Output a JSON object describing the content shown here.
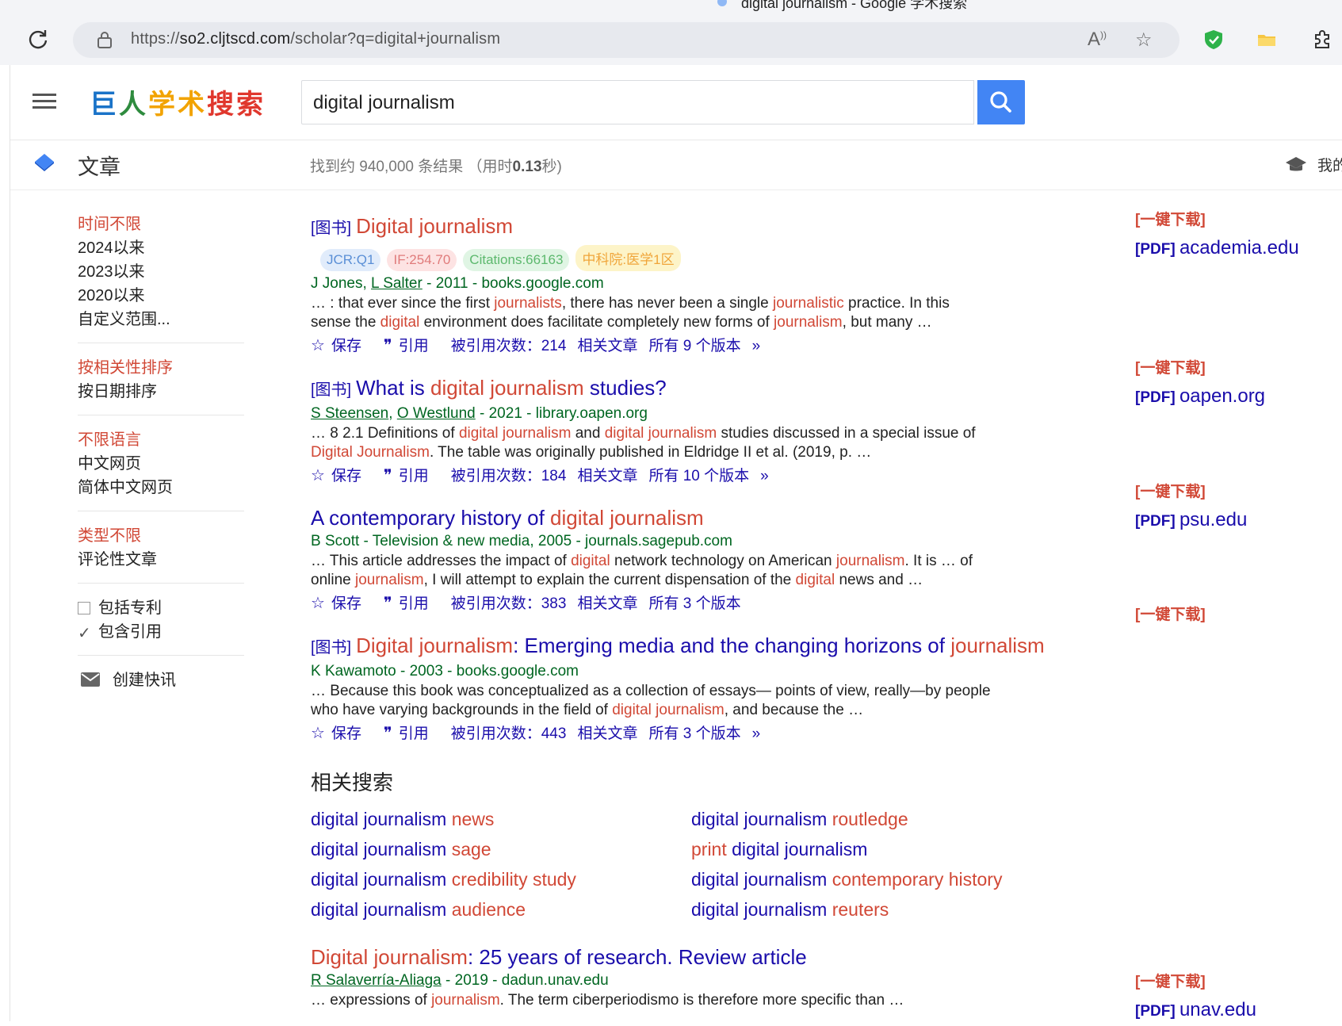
{
  "browser": {
    "tab_title": "digital journalism - Google 学术搜索",
    "url_prefix": "https://",
    "url_host": "so2.cljtscd.com",
    "url_path": "/scholar?q=digital+journalism"
  },
  "header": {
    "logo": [
      "巨",
      "人",
      "学术",
      "搜索"
    ],
    "search_value": "digital journalism"
  },
  "subbar": {
    "section": "文章",
    "stats_prefix": "找到约 940,000 条结果 （用时",
    "stats_time": "0.13",
    "stats_suffix": "秒)",
    "my_library": "我的"
  },
  "sidebar": {
    "time": [
      "时间不限",
      "2024以来",
      "2023以来",
      "2020以来",
      "自定义范围..."
    ],
    "sort": [
      "按相关性排序",
      "按日期排序"
    ],
    "lang": [
      "不限语言",
      "中文网页",
      "简体中文网页"
    ],
    "type": [
      "类型不限",
      "评论性文章"
    ],
    "include_patents": "包括专利",
    "include_citations": "包含引用",
    "create_alert": "创建快讯"
  },
  "actions": {
    "save": "保存",
    "cite": "引用",
    "cited_by_prefix": "被引用次数：",
    "related": "相关文章",
    "versions_prefix": "所有 ",
    "versions_suffix": " 个版本"
  },
  "results": [
    {
      "tag": "[图书]",
      "title_parts": [
        {
          "t": "Digital journalism",
          "h": true
        }
      ],
      "badges": [
        "JCR:Q1",
        "IF:254.70",
        "Citations:66163",
        "中科院:医学1区"
      ],
      "authors": [
        {
          "t": "J Jones",
          "u": false
        },
        {
          "t": "L Salter",
          "u": true
        }
      ],
      "meta": " - 2011 - books.google.com",
      "snippet": [
        {
          "t": "… : that ever since the first ",
          "h": false
        },
        {
          "t": "journalists",
          "h": true
        },
        {
          "t": ", there has never been a single ",
          "h": false
        },
        {
          "t": "journalistic",
          "h": true
        },
        {
          "t": " practice. In this sense the ",
          "h": false
        },
        {
          "t": "digital",
          "h": true
        },
        {
          "t": " environment does facilitate completely new forms of ",
          "h": false
        },
        {
          "t": "journalism",
          "h": true
        },
        {
          "t": ", but many …",
          "h": false
        }
      ],
      "cited_by": "214",
      "versions": "9",
      "more": true,
      "download": "[一键下载]",
      "pdf_source": "academia.edu"
    },
    {
      "tag": "[图书]",
      "title_parts": [
        {
          "t": "What is ",
          "h": false
        },
        {
          "t": "digital journalism",
          "h": true
        },
        {
          "t": " studies?",
          "h": false
        }
      ],
      "badges": [],
      "authors": [
        {
          "t": "S Steensen",
          "u": true
        },
        {
          "t": "O Westlund",
          "u": true
        }
      ],
      "meta": " - 2021 - library.oapen.org",
      "snippet": [
        {
          "t": "… 8 2.1 Definitions of ",
          "h": false
        },
        {
          "t": "digital journalism",
          "h": true
        },
        {
          "t": " and ",
          "h": false
        },
        {
          "t": "digital journalism",
          "h": true
        },
        {
          "t": " studies discussed in a special issue of ",
          "h": false
        },
        {
          "t": "Digital Journalism",
          "h": true
        },
        {
          "t": ". The table was originally published in Eldridge II et al. (2019, p. …",
          "h": false
        }
      ],
      "cited_by": "184",
      "versions": "10",
      "more": true,
      "download": "[一键下载]",
      "pdf_source": "oapen.org"
    },
    {
      "tag": "",
      "title_parts": [
        {
          "t": "A contemporary history of ",
          "h": false
        },
        {
          "t": "digital journalism",
          "h": true
        }
      ],
      "badges": [],
      "authors": [
        {
          "t": "B Scott",
          "u": false
        }
      ],
      "meta": " - Television & new media, 2005 - journals.sagepub.com",
      "snippet": [
        {
          "t": "… This article addresses the impact of ",
          "h": false
        },
        {
          "t": "digital",
          "h": true
        },
        {
          "t": " network technology on American ",
          "h": false
        },
        {
          "t": "journalism",
          "h": true
        },
        {
          "t": ". It is … of online ",
          "h": false
        },
        {
          "t": "journalism",
          "h": true
        },
        {
          "t": ", I will attempt to explain the current dispensation of the ",
          "h": false
        },
        {
          "t": "digital",
          "h": true
        },
        {
          "t": " news and …",
          "h": false
        }
      ],
      "cited_by": "383",
      "versions": "3",
      "more": false,
      "download": "[一键下载]",
      "pdf_source": "psu.edu"
    },
    {
      "tag": "[图书]",
      "title_parts": [
        {
          "t": "Digital journalism",
          "h": true
        },
        {
          "t": ": Emerging media and the changing horizons of ",
          "h": false
        },
        {
          "t": "journalism",
          "h": true
        }
      ],
      "badges": [],
      "authors": [
        {
          "t": "K Kawamoto",
          "u": false
        }
      ],
      "meta": " - 2003 - books.google.com",
      "snippet": [
        {
          "t": "… Because this book was conceptualized as a collection of essays— points of view, really—by people who have varying backgrounds in the field of ",
          "h": false
        },
        {
          "t": "digital journalism",
          "h": true
        },
        {
          "t": ", and because the …",
          "h": false
        }
      ],
      "cited_by": "443",
      "versions": "3",
      "more": true,
      "download": "[一键下载]",
      "pdf_source": ""
    }
  ],
  "related_title": "相关搜索",
  "related": [
    [
      {
        "t": "digital journalism ",
        "h": false
      },
      {
        "t": "news",
        "h": true
      }
    ],
    [
      {
        "t": "digital journalism ",
        "h": false
      },
      {
        "t": "routledge",
        "h": true
      }
    ],
    [
      {
        "t": "digital journalism ",
        "h": false
      },
      {
        "t": "sage",
        "h": true
      }
    ],
    [
      {
        "t": "print",
        "h": true
      },
      {
        "t": " digital journalism",
        "h": false
      }
    ],
    [
      {
        "t": "digital journalism ",
        "h": false
      },
      {
        "t": "credibility study",
        "h": true
      }
    ],
    [
      {
        "t": "digital journalism ",
        "h": false
      },
      {
        "t": "contemporary history",
        "h": true
      }
    ],
    [
      {
        "t": "digital journalism ",
        "h": false
      },
      {
        "t": "audience",
        "h": true
      }
    ],
    [
      {
        "t": "digital journalism ",
        "h": false
      },
      {
        "t": "reuters",
        "h": true
      }
    ]
  ],
  "last_result": {
    "title_parts": [
      {
        "t": "Digital journalism",
        "h": true
      },
      {
        "t": ": 25 years of research. Review article",
        "h": false
      }
    ],
    "authors": [
      {
        "t": "R Salaverría-Aliaga",
        "u": true
      }
    ],
    "meta": " - 2019 - dadun.unav.edu",
    "snippet": [
      {
        "t": "… expressions of ",
        "h": false
      },
      {
        "t": "journalism",
        "h": true
      },
      {
        "t": ". The term ciberperiodismo is therefore more specific than …",
        "h": false
      }
    ],
    "download": "[一键下载]",
    "pdf_source": "unav.edu"
  },
  "pdf_label": "[PDF]",
  "colors": {
    "link": "#1a0dab",
    "highlight": "#d14836",
    "meta": "#006621",
    "search_button": "#4285f4"
  }
}
